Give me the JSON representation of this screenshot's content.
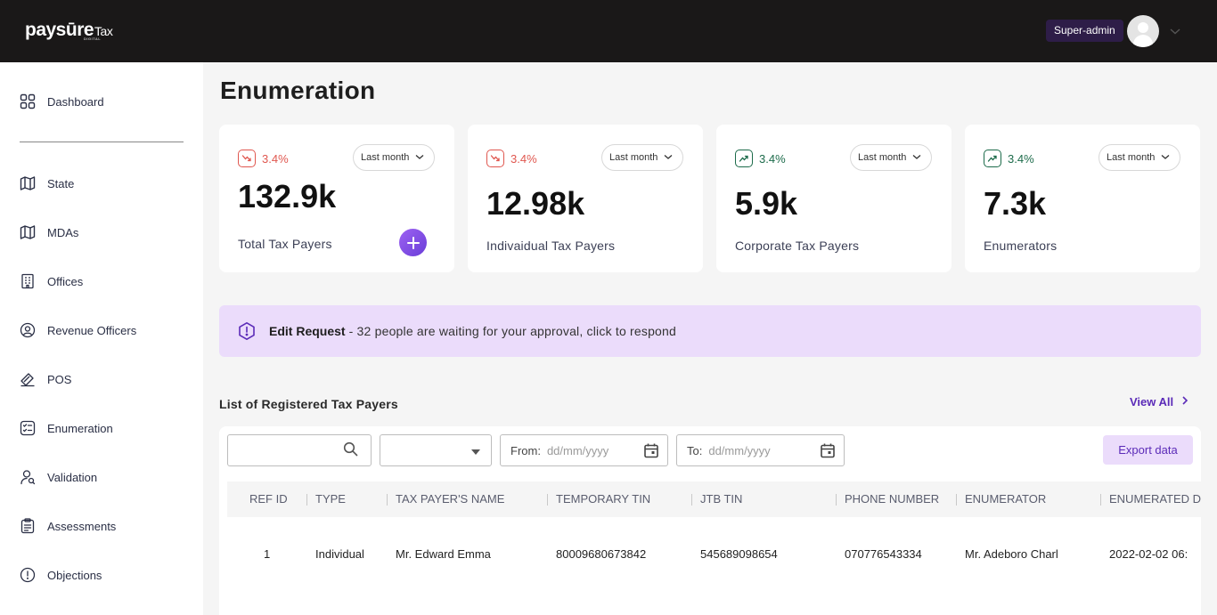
{
  "brand": {
    "name": "paysūre",
    "suffix": "Tax",
    "tagline": "DIGITAL"
  },
  "header": {
    "role_badge": "Super-admin",
    "avatar_icon": "user-avatar-icon"
  },
  "sidebar": {
    "items": [
      {
        "label": "Dashboard",
        "icon": "grid-icon"
      },
      {
        "label": "State",
        "icon": "map-icon"
      },
      {
        "label": "MDAs",
        "icon": "map-icon"
      },
      {
        "label": "Offices",
        "icon": "building-icon"
      },
      {
        "label": "Revenue Officers",
        "icon": "officer-icon"
      },
      {
        "label": "POS",
        "icon": "pos-icon"
      },
      {
        "label": "Enumeration",
        "icon": "checklist-icon"
      },
      {
        "label": "Validation",
        "icon": "user-search-icon"
      },
      {
        "label": "Assessments",
        "icon": "clipboard-icon"
      },
      {
        "label": "Objections",
        "icon": "alert-icon"
      }
    ]
  },
  "page": {
    "title": "Enumeration"
  },
  "cards": [
    {
      "trend": "3.4%",
      "direction": "down",
      "period": "Last month",
      "value": "132.9k",
      "caption": "Total Tax Payers"
    },
    {
      "trend": "3.4%",
      "direction": "down",
      "period": "Last month",
      "value": "12.98k",
      "caption": "Indivaidual Tax Payers"
    },
    {
      "trend": "3.4%",
      "direction": "up",
      "period": "Last month",
      "value": "5.9k",
      "caption": "Corporate Tax Payers"
    },
    {
      "trend": "3.4%",
      "direction": "up",
      "period": "Last month",
      "value": "7.3k",
      "caption": "Enumerators"
    }
  ],
  "alert": {
    "title": "Edit Request",
    "text": "- 32 people are waiting for your approval, click to respond"
  },
  "list": {
    "title": "List of Registered Tax Payers",
    "view_all": "View All",
    "filters": {
      "search_value": "",
      "select_value": "",
      "from_label": "From:",
      "from_placeholder": "dd/mm/yyyy",
      "to_label": "To:",
      "to_placeholder": "dd/mm/yyyy"
    },
    "export_label": "Export data",
    "columns": [
      "REF ID",
      "TYPE",
      "TAX PAYER'S NAME",
      "TEMPORARY TIN",
      "JTB TIN",
      "PHONE NUMBER",
      "ENUMERATOR",
      "ENUMERATED DATE"
    ],
    "rows": [
      [
        "1",
        "Individual",
        "Mr. Edward Emma",
        "80009680673842",
        "545689098654",
        "070776543334",
        "Mr. Adeboro Charl",
        "2022-02-02 06:"
      ]
    ]
  },
  "colors": {
    "topbar": "#1a1818",
    "accent_purple": "#5b2bb8",
    "alert_bg": "#ebdcfb",
    "trend_down": "#e0574f",
    "trend_up": "#1c6b4a"
  }
}
